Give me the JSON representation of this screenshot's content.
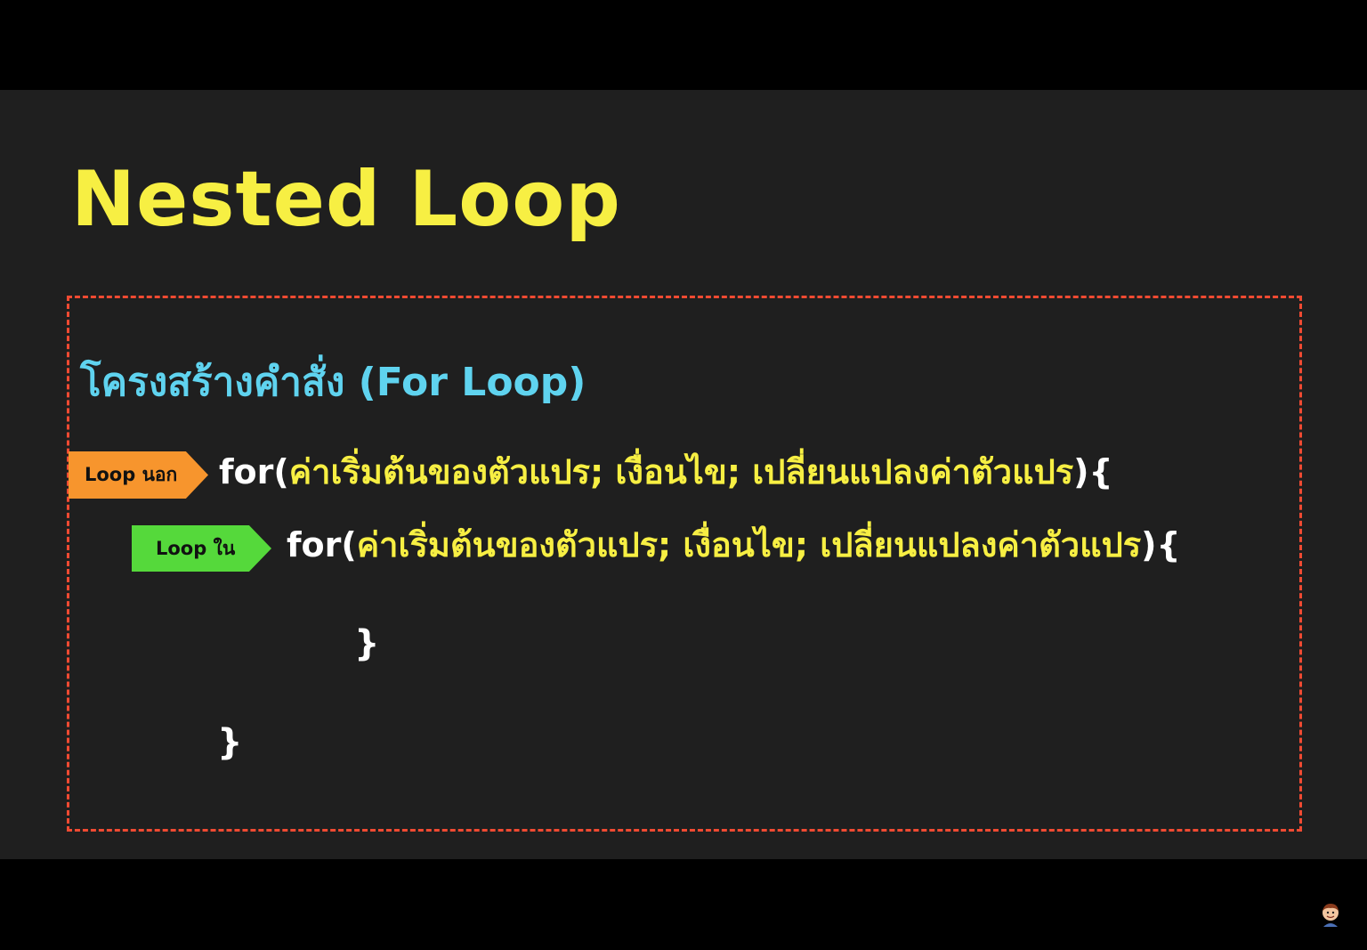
{
  "slide": {
    "title": "Nested Loop",
    "subtitle": "โครงสร้างคำสั่ง (For Loop)"
  },
  "outer_loop": {
    "tag_label": "Loop นอก",
    "keyword": "for(",
    "params": "ค่าเริ่มต้นของตัวแปร; เงื่อนไข; เปลี่ยนแปลงค่าตัวแปร",
    "open": "){",
    "close": "}"
  },
  "inner_loop": {
    "tag_label": "Loop ใน",
    "keyword": "for(",
    "params": "ค่าเริ่มต้นของตัวแปร; เงื่อนไข; เปลี่ยนแปลงค่าตัวแปร",
    "open": "){",
    "close": "}"
  },
  "colors": {
    "title": "#f7ef43",
    "subtitle": "#5fd3ef",
    "params": "#f7ef43",
    "box_border": "#f04a32",
    "outer_tag": "#f7952d",
    "inner_tag": "#55d93b",
    "slide_bg": "#1f1f1f",
    "letterbox": "#000000"
  },
  "icons": {
    "presenter_avatar": "presenter-avatar-icon"
  }
}
